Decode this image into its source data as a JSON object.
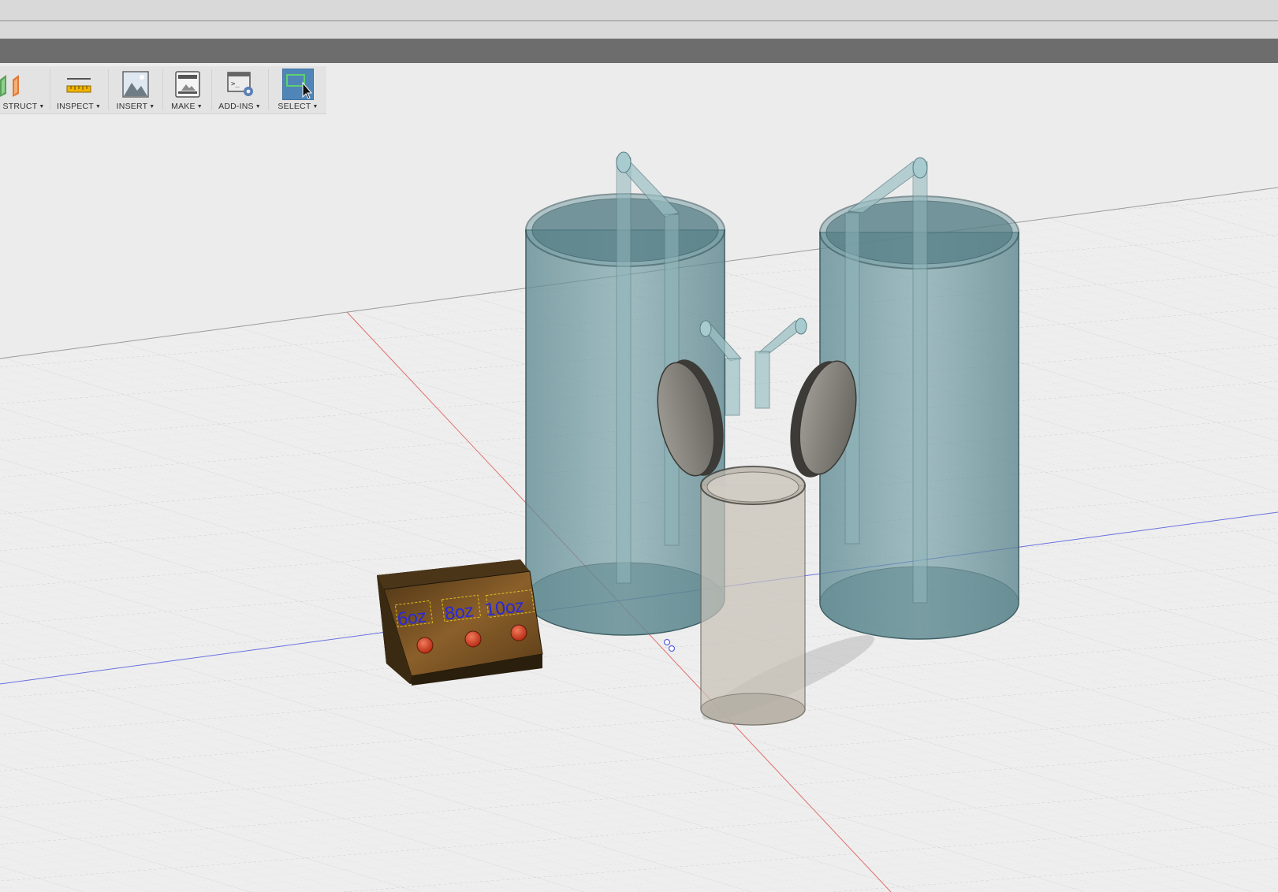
{
  "toolbar": {
    "items": [
      {
        "label": "STRUCT",
        "icon": "construct-icon"
      },
      {
        "label": "INSPECT",
        "icon": "inspect-ruler-icon"
      },
      {
        "label": "INSERT",
        "icon": "insert-image-icon"
      },
      {
        "label": "MAKE",
        "icon": "make-3d-print-icon"
      },
      {
        "label": "ADD-INS",
        "icon": "add-ins-script-icon"
      },
      {
        "label": "SELECT",
        "icon": "select-cursor-icon"
      }
    ],
    "active_item": "SELECT"
  },
  "model": {
    "button_labels": [
      "6oz",
      "8oz",
      "10oz"
    ]
  },
  "colors": {
    "tank": "#6f9aa1",
    "cup": "#c8c2b8",
    "box_wood": "#6e4a22",
    "button_red": "#cf3b26",
    "select_active": "#4f86b7",
    "grid": "#d0d0d0",
    "axis_x": "#e05a5a",
    "axis_z": "#5a62e0"
  }
}
